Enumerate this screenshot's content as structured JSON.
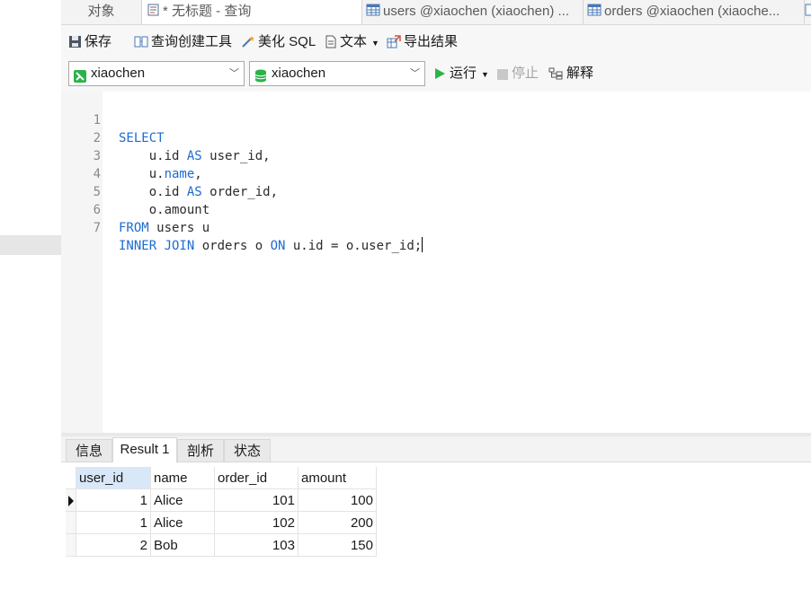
{
  "tabs": [
    {
      "label": "对象",
      "icon": "none"
    },
    {
      "label": "* 无标题 - 查询",
      "icon": "query-icon"
    },
    {
      "label": "users @xiaochen (xiaochen) ...",
      "icon": "table-icon"
    },
    {
      "label": "orders @xiaochen (xiaoche...",
      "icon": "table-icon"
    }
  ],
  "toolbar": {
    "save": "保存",
    "query_builder": "查询创建工具",
    "beautify": "美化 SQL",
    "text": "文本",
    "export": "导出结果"
  },
  "selectors": {
    "connection": "xiaochen",
    "database": "xiaochen"
  },
  "run_bar": {
    "run": "运行",
    "stop": "停止",
    "explain": "解释"
  },
  "editor": {
    "lines": [
      {
        "n": "1",
        "kw1": "SELECT",
        "rest": ""
      },
      {
        "n": "2",
        "pre": "    u.id ",
        "kw": "AS",
        "post": " user_id,"
      },
      {
        "n": "3",
        "pre": "    u.",
        "kw": "name",
        "post": ","
      },
      {
        "n": "4",
        "pre": "    o.id ",
        "kw": "AS",
        "post": " order_id,"
      },
      {
        "n": "5",
        "pre": "    o.amount",
        "kw": "",
        "post": ""
      },
      {
        "n": "6",
        "kw1": "FROM",
        "rest": " users u"
      },
      {
        "n": "7",
        "kw1": "INNER JOIN",
        "mid": " orders o ",
        "kw2": "ON",
        "rest": " u.id = o.user_id;"
      }
    ]
  },
  "result_tabs": [
    "信息",
    "Result 1",
    "剖析",
    "状态"
  ],
  "result": {
    "columns": [
      "user_id",
      "name",
      "order_id",
      "amount"
    ],
    "rows": [
      [
        "1",
        "Alice",
        "101",
        "100"
      ],
      [
        "1",
        "Alice",
        "102",
        "200"
      ],
      [
        "2",
        "Bob",
        "103",
        "150"
      ]
    ]
  },
  "colors": {
    "keyword": "#1d6bd1",
    "run_green": "#2bb34a",
    "header_selected": "#d8e8f8"
  }
}
